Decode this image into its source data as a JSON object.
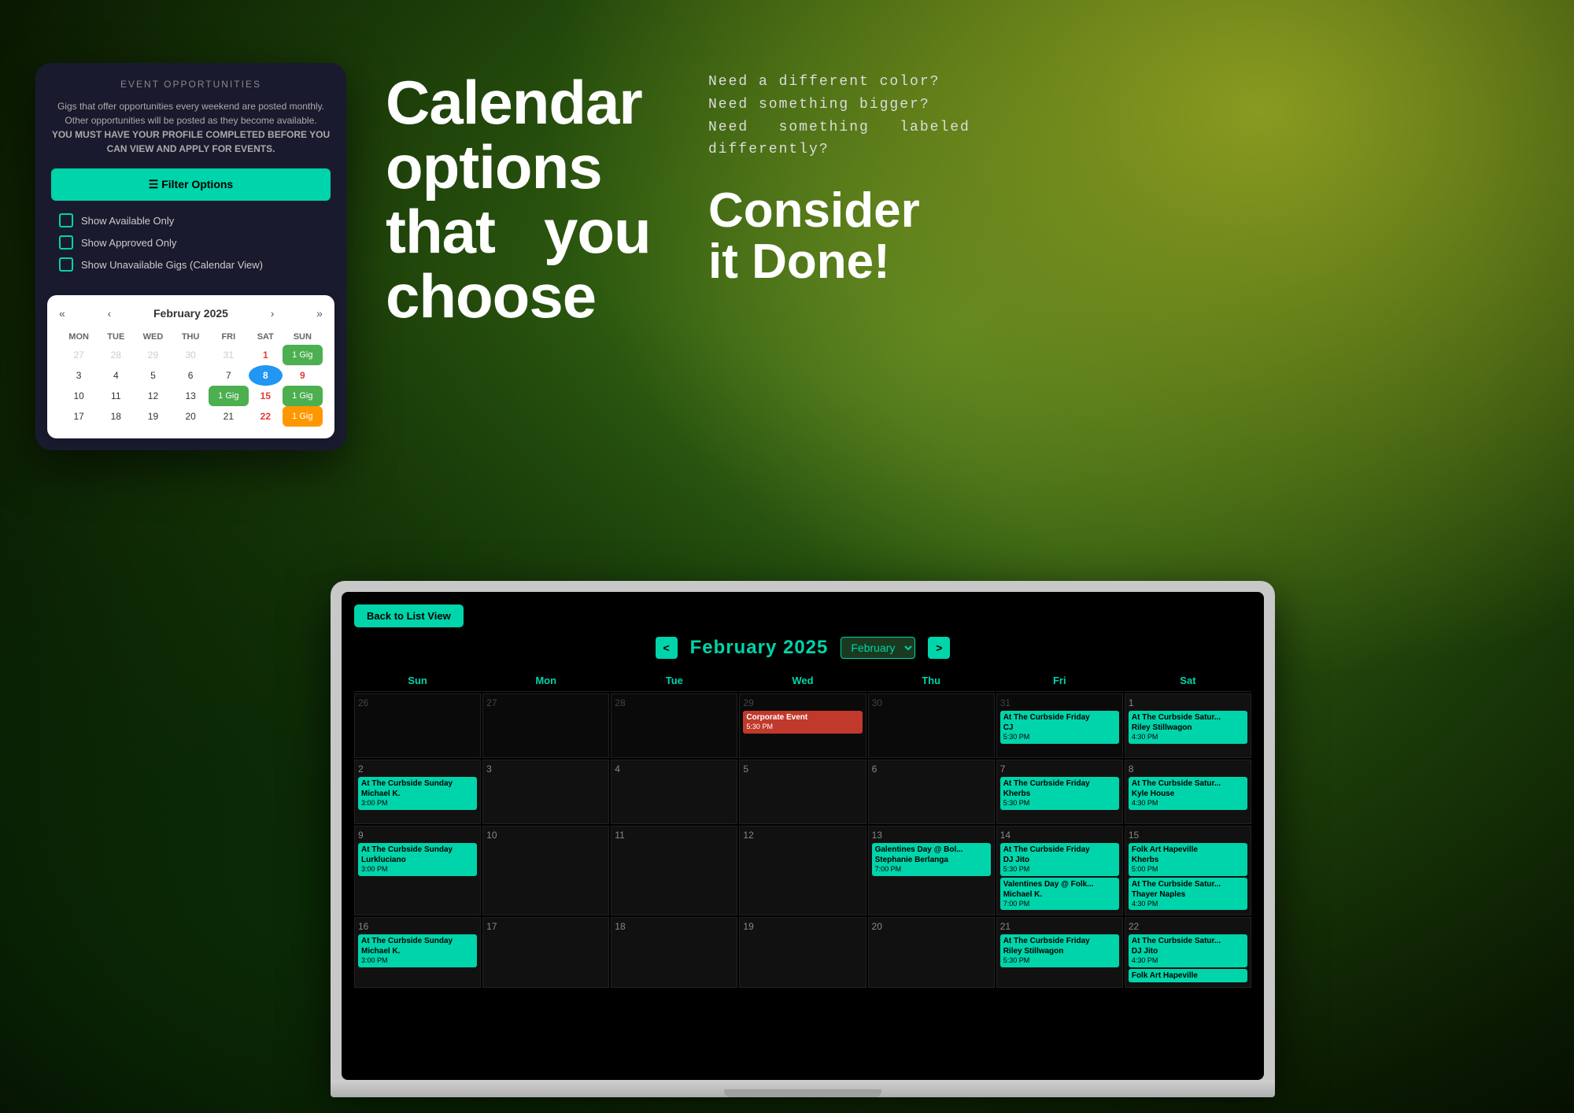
{
  "background": {
    "gradient": "green-dark"
  },
  "mobile_card": {
    "event_panel": {
      "title": "EVENT OPPORTUNITIES",
      "description_line1": "Gigs that offer opportunities every weekend are posted monthly.",
      "description_line2": "Other opportunities will be posted as they become available.",
      "description_line3": "YOU MUST HAVE YOUR PROFILE COMPLETED BEFORE YOU CAN VIEW AND APPLY FOR EVENTS.",
      "filter_button": "☰ Filter Options",
      "checkboxes": [
        "Show Available Only",
        "Show Approved Only",
        "Show Unavailable Gigs (Calendar View)"
      ]
    },
    "mini_calendar": {
      "title": "February 2025",
      "nav_prev_prev": "«",
      "nav_prev": "‹",
      "nav_next": "›",
      "nav_next_next": "»",
      "days_header": [
        "MON",
        "TUE",
        "WED",
        "THU",
        "FRI",
        "SAT",
        "SUN"
      ],
      "weeks": [
        [
          "27",
          "28",
          "29",
          "30",
          "31",
          "1",
          "1 Gig"
        ],
        [
          "3",
          "4",
          "5",
          "6",
          "7",
          "8",
          "9"
        ],
        [
          "10",
          "11",
          "12",
          "13",
          "1 Gig",
          "15",
          "1 Gig"
        ],
        [
          "17",
          "18",
          "19",
          "20",
          "21",
          "22",
          "1 Gig"
        ]
      ]
    }
  },
  "hero_text": {
    "main": "Calendar options that you choose"
  },
  "right_text": {
    "subtitle": "Need a different color?\nNeed something bigger?\nNeed  something  labeled\ndifferently?",
    "consider_done": "Consider it Done!"
  },
  "laptop": {
    "calendar_app": {
      "back_button": "Back to List View",
      "nav_prev": "<",
      "nav_next": ">",
      "month_title": "February 2025",
      "month_select": "February",
      "day_headers": [
        "Sun",
        "Mon",
        "Tue",
        "Wed",
        "Thu",
        "Fri",
        "Sat"
      ],
      "weeks": [
        {
          "days": [
            {
              "num": "26",
              "prev": true,
              "events": []
            },
            {
              "num": "27",
              "prev": true,
              "events": []
            },
            {
              "num": "28",
              "prev": true,
              "events": []
            },
            {
              "num": "29",
              "prev": true,
              "events": [
                {
                  "title": "Corporate Event",
                  "time": "5:30 PM",
                  "color": "red"
                }
              ]
            },
            {
              "num": "30",
              "prev": true,
              "events": []
            },
            {
              "num": "31",
              "prev": true,
              "events": [
                {
                  "title": "At The Curbside Friday",
                  "subtitle": "CJ",
                  "time": "5:30 PM",
                  "color": "teal"
                }
              ]
            },
            {
              "num": "1",
              "events": [
                {
                  "title": "At The Curbside Satur...",
                  "subtitle": "Riley Stillwagon",
                  "time": "4:30 PM",
                  "color": "teal"
                }
              ]
            }
          ]
        },
        {
          "days": [
            {
              "num": "2",
              "events": [
                {
                  "title": "At The Curbside Sunday",
                  "subtitle": "Michael K.",
                  "time": "3:00 PM",
                  "color": "teal"
                }
              ]
            },
            {
              "num": "3",
              "events": []
            },
            {
              "num": "4",
              "events": []
            },
            {
              "num": "5",
              "events": []
            },
            {
              "num": "6",
              "events": []
            },
            {
              "num": "7",
              "events": [
                {
                  "title": "At The Curbside Friday",
                  "subtitle": "Kherbs",
                  "time": "5:30 PM",
                  "color": "teal"
                }
              ]
            },
            {
              "num": "8",
              "events": [
                {
                  "title": "At The Curbside Satur...",
                  "subtitle": "Kyle House",
                  "time": "4:30 PM",
                  "color": "teal"
                }
              ]
            }
          ]
        },
        {
          "days": [
            {
              "num": "9",
              "events": [
                {
                  "title": "At The Curbside Sunday",
                  "subtitle": "Lurkluciano",
                  "time": "3:00 PM",
                  "color": "teal"
                }
              ]
            },
            {
              "num": "10",
              "events": []
            },
            {
              "num": "11",
              "events": []
            },
            {
              "num": "12",
              "events": []
            },
            {
              "num": "13",
              "events": [
                {
                  "title": "Galentines Day @ Bol...",
                  "subtitle": "Stephanie Berlanga",
                  "time": "7:00 PM",
                  "color": "teal"
                }
              ]
            },
            {
              "num": "14",
              "events": [
                {
                  "title": "At The Curbside Friday",
                  "subtitle": "DJ Jito",
                  "time": "5:30 PM",
                  "color": "teal"
                },
                {
                  "title": "Valentines Day @ Folk...",
                  "subtitle": "Michael K.",
                  "time": "7:00 PM",
                  "color": "teal"
                }
              ]
            },
            {
              "num": "15",
              "events": [
                {
                  "title": "Folk Art Hapeville",
                  "subtitle": "Kherbs",
                  "time": "5:00 PM",
                  "color": "teal"
                },
                {
                  "title": "At The Curbside Satur...",
                  "subtitle": "Thayer Naples",
                  "time": "4:30 PM",
                  "color": "teal"
                }
              ]
            }
          ]
        },
        {
          "days": [
            {
              "num": "16",
              "events": [
                {
                  "title": "At The Curbside Sunday",
                  "subtitle": "Michael K.",
                  "time": "3:00 PM",
                  "color": "teal"
                }
              ]
            },
            {
              "num": "17",
              "events": []
            },
            {
              "num": "18",
              "events": []
            },
            {
              "num": "19",
              "events": []
            },
            {
              "num": "20",
              "events": []
            },
            {
              "num": "21",
              "events": [
                {
                  "title": "At The Curbside Friday",
                  "subtitle": "Riley Stillwagon",
                  "time": "5:30 PM",
                  "color": "teal"
                }
              ]
            },
            {
              "num": "22",
              "events": [
                {
                  "title": "At The Curbside Satur...",
                  "subtitle": "DJ Jito",
                  "time": "4:30 PM",
                  "color": "teal"
                },
                {
                  "title": "Folk Art Hapeville",
                  "subtitle": "...",
                  "time": "",
                  "color": "teal"
                }
              ]
            }
          ]
        }
      ]
    }
  }
}
